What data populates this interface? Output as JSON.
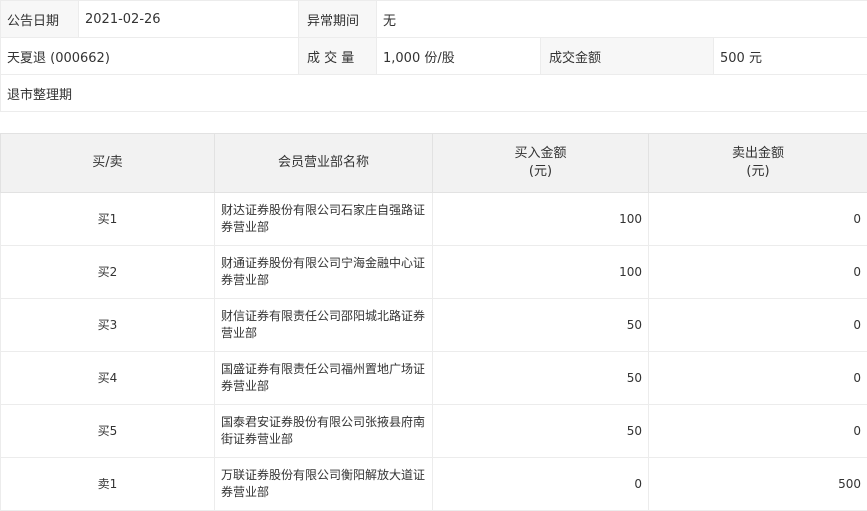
{
  "info": {
    "announce_date_label": "公告日期",
    "announce_date_value": "2021-02-26",
    "abnormal_period_label": "异常期间",
    "abnormal_period_value": "无",
    "stock_name": "天夏退 (000662)",
    "volume_label": "成 交 量",
    "volume_value": "1,000 份/股",
    "amount_label": "成交金额",
    "amount_value": "500 元",
    "reason": "退市整理期"
  },
  "table": {
    "headers": {
      "side": "买/卖",
      "member": "会员营业部名称",
      "buy_line1": "买入金额",
      "buy_line2": "(元)",
      "sell_line1": "卖出金额",
      "sell_line2": "(元)"
    },
    "rows": [
      {
        "side": "买1",
        "name": "财达证券股份有限公司石家庄自强路证券营业部",
        "buy": "100",
        "sell": "0"
      },
      {
        "side": "买2",
        "name": "财通证券股份有限公司宁海金融中心证券营业部",
        "buy": "100",
        "sell": "0"
      },
      {
        "side": "买3",
        "name": "财信证券有限责任公司邵阳城北路证券营业部",
        "buy": "50",
        "sell": "0"
      },
      {
        "side": "买4",
        "name": "国盛证券有限责任公司福州置地广场证券营业部",
        "buy": "50",
        "sell": "0"
      },
      {
        "side": "买5",
        "name": "国泰君安证券股份有限公司张掖县府南街证券营业部",
        "buy": "50",
        "sell": "0"
      },
      {
        "side": "卖1",
        "name": "万联证券股份有限公司衡阳解放大道证券营业部",
        "buy": "0",
        "sell": "500"
      }
    ]
  }
}
